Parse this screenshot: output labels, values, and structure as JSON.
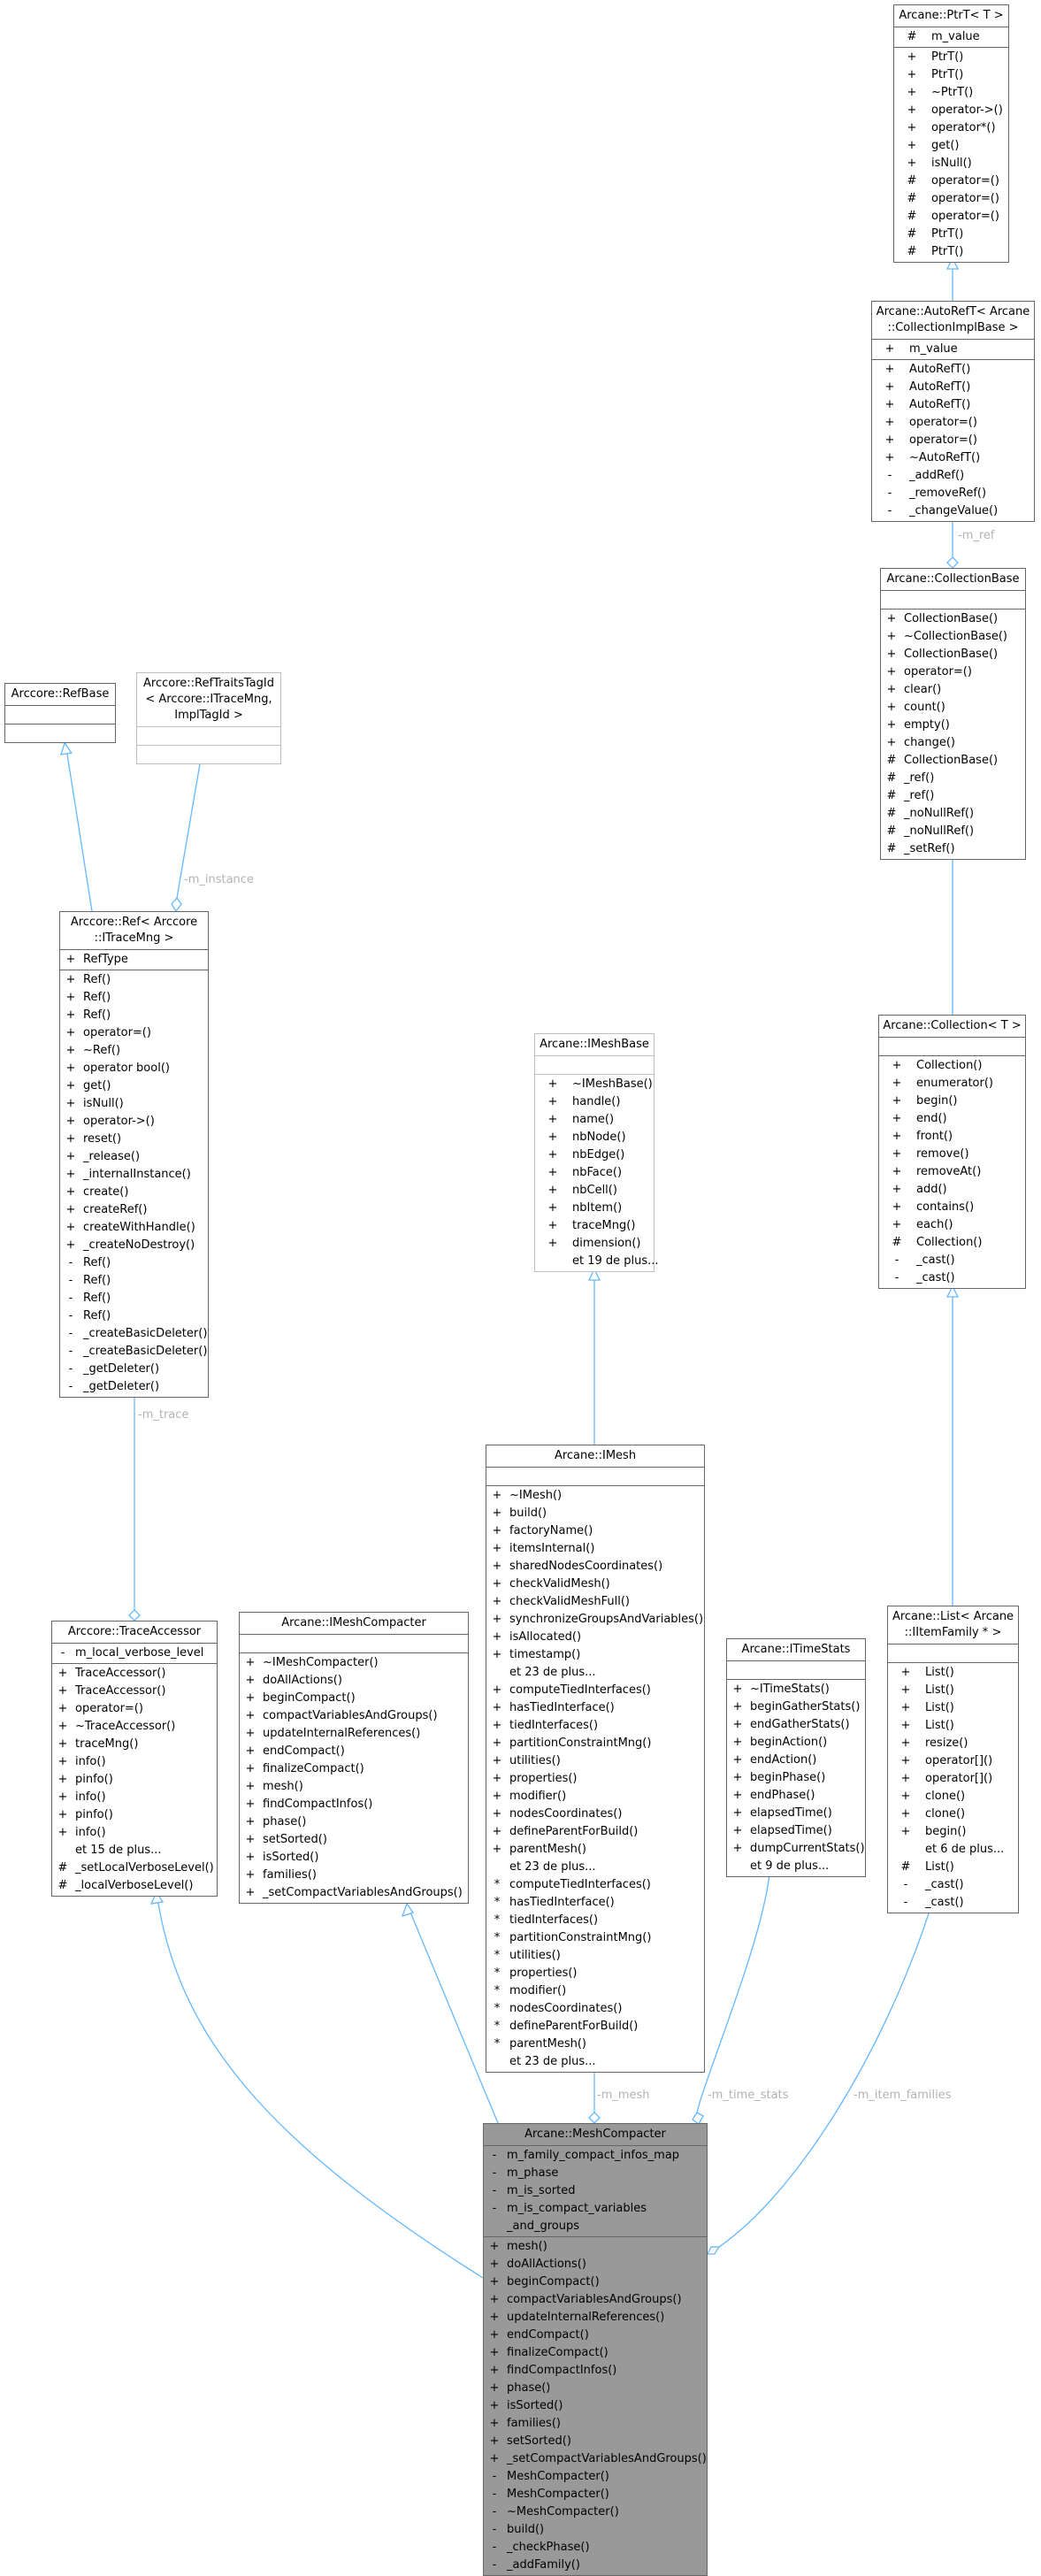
{
  "diagram": {
    "classes": {
      "ptrt": {
        "title": "Arcane::PtrT< T >",
        "attributes": [
          {
            "vis": "#",
            "name": "m_value"
          }
        ],
        "methods": [
          {
            "vis": "+",
            "name": "PtrT()"
          },
          {
            "vis": "+",
            "name": "PtrT()"
          },
          {
            "vis": "+",
            "name": "~PtrT()"
          },
          {
            "vis": "+",
            "name": "operator->()"
          },
          {
            "vis": "+",
            "name": "operator*()"
          },
          {
            "vis": "+",
            "name": "get()"
          },
          {
            "vis": "+",
            "name": "isNull()"
          },
          {
            "vis": "#",
            "name": "operator=()"
          },
          {
            "vis": "#",
            "name": "operator=()"
          },
          {
            "vis": "#",
            "name": "operator=()"
          },
          {
            "vis": "#",
            "name": "PtrT()"
          },
          {
            "vis": "#",
            "name": "PtrT()"
          }
        ]
      },
      "autoreft": {
        "title": "Arcane::AutoRefT< Arcane ::CollectionImplBase >",
        "attributes": [
          {
            "vis": "+",
            "name": "m_value"
          }
        ],
        "methods": [
          {
            "vis": "+",
            "name": "AutoRefT()"
          },
          {
            "vis": "+",
            "name": "AutoRefT()"
          },
          {
            "vis": "+",
            "name": "AutoRefT()"
          },
          {
            "vis": "+",
            "name": "operator=()"
          },
          {
            "vis": "+",
            "name": "operator=()"
          },
          {
            "vis": "+",
            "name": "~AutoRefT()"
          },
          {
            "vis": "-",
            "name": "_addRef()"
          },
          {
            "vis": "-",
            "name": "_removeRef()"
          },
          {
            "vis": "-",
            "name": "_changeValue()"
          }
        ]
      },
      "collectionbase": {
        "title": "Arcane::CollectionBase",
        "attributes": [],
        "methods": [
          {
            "vis": "+",
            "name": "CollectionBase()"
          },
          {
            "vis": "+",
            "name": "~CollectionBase()"
          },
          {
            "vis": "+",
            "name": "CollectionBase()"
          },
          {
            "vis": "+",
            "name": "operator=()"
          },
          {
            "vis": "+",
            "name": "clear()"
          },
          {
            "vis": "+",
            "name": "count()"
          },
          {
            "vis": "+",
            "name": "empty()"
          },
          {
            "vis": "+",
            "name": "change()"
          },
          {
            "vis": "#",
            "name": "CollectionBase()"
          },
          {
            "vis": "#",
            "name": "_ref()"
          },
          {
            "vis": "#",
            "name": "_ref()"
          },
          {
            "vis": "#",
            "name": "_noNullRef()"
          },
          {
            "vis": "#",
            "name": "_noNullRef()"
          },
          {
            "vis": "#",
            "name": "_setRef()"
          }
        ]
      },
      "collection": {
        "title": "Arcane::Collection< T >",
        "attributes": [],
        "methods": [
          {
            "vis": "+",
            "name": "Collection()"
          },
          {
            "vis": "+",
            "name": "enumerator()"
          },
          {
            "vis": "+",
            "name": "begin()"
          },
          {
            "vis": "+",
            "name": "end()"
          },
          {
            "vis": "+",
            "name": "front()"
          },
          {
            "vis": "+",
            "name": "remove()"
          },
          {
            "vis": "+",
            "name": "removeAt()"
          },
          {
            "vis": "+",
            "name": "add()"
          },
          {
            "vis": "+",
            "name": "contains()"
          },
          {
            "vis": "+",
            "name": "each()"
          },
          {
            "vis": "#",
            "name": "Collection()"
          },
          {
            "vis": "-",
            "name": "_cast()"
          },
          {
            "vis": "-",
            "name": "_cast()"
          }
        ]
      },
      "list": {
        "title": "Arcane::List< Arcane ::IItemFamily * >",
        "attributes": [],
        "methods": [
          {
            "vis": "+",
            "name": "List()"
          },
          {
            "vis": "+",
            "name": "List()"
          },
          {
            "vis": "+",
            "name": "List()"
          },
          {
            "vis": "+",
            "name": "List()"
          },
          {
            "vis": "+",
            "name": "resize()"
          },
          {
            "vis": "+",
            "name": "operator[]()"
          },
          {
            "vis": "+",
            "name": "operator[]()"
          },
          {
            "vis": "+",
            "name": "clone()"
          },
          {
            "vis": "+",
            "name": "clone()"
          },
          {
            "vis": "+",
            "name": "begin()"
          },
          {
            "vis": "",
            "name": "et 6 de plus..."
          },
          {
            "vis": "#",
            "name": "List()"
          },
          {
            "vis": "-",
            "name": "_cast()"
          },
          {
            "vis": "-",
            "name": "_cast()"
          }
        ]
      },
      "refbase": {
        "title": "Arccore::RefBase",
        "attributes": [],
        "methods": []
      },
      "reftraits": {
        "title": "Arccore::RefTraitsTagId < Arccore::ITraceMng, ImplTagId >",
        "attributes": [],
        "methods": []
      },
      "ref": {
        "title": "Arccore::Ref< Arccore ::ITraceMng >",
        "attributes": [
          {
            "vis": "+",
            "name": "RefType"
          }
        ],
        "methods": [
          {
            "vis": "+",
            "name": "Ref()"
          },
          {
            "vis": "+",
            "name": "Ref()"
          },
          {
            "vis": "+",
            "name": "Ref()"
          },
          {
            "vis": "+",
            "name": "operator=()"
          },
          {
            "vis": "+",
            "name": "~Ref()"
          },
          {
            "vis": "+",
            "name": "operator bool()"
          },
          {
            "vis": "+",
            "name": "get()"
          },
          {
            "vis": "+",
            "name": "isNull()"
          },
          {
            "vis": "+",
            "name": "operator->()"
          },
          {
            "vis": "+",
            "name": "reset()"
          },
          {
            "vis": "+",
            "name": "_release()"
          },
          {
            "vis": "+",
            "name": "_internalInstance()"
          },
          {
            "vis": "+",
            "name": "create()"
          },
          {
            "vis": "+",
            "name": "createRef()"
          },
          {
            "vis": "+",
            "name": "createWithHandle()"
          },
          {
            "vis": "+",
            "name": "_createNoDestroy()"
          },
          {
            "vis": "-",
            "name": "Ref()"
          },
          {
            "vis": "-",
            "name": "Ref()"
          },
          {
            "vis": "-",
            "name": "Ref()"
          },
          {
            "vis": "-",
            "name": "Ref()"
          },
          {
            "vis": "-",
            "name": "_createBasicDeleter()"
          },
          {
            "vis": "-",
            "name": "_createBasicDeleter()"
          },
          {
            "vis": "-",
            "name": "_getDeleter()"
          },
          {
            "vis": "-",
            "name": "_getDeleter()"
          }
        ]
      },
      "traceaccessor": {
        "title": "Arccore::TraceAccessor",
        "attributes": [
          {
            "vis": "-",
            "name": "m_local_verbose_level"
          }
        ],
        "methods": [
          {
            "vis": "+",
            "name": "TraceAccessor()"
          },
          {
            "vis": "+",
            "name": "TraceAccessor()"
          },
          {
            "vis": "+",
            "name": "operator=()"
          },
          {
            "vis": "+",
            "name": "~TraceAccessor()"
          },
          {
            "vis": "+",
            "name": "traceMng()"
          },
          {
            "vis": "+",
            "name": "info()"
          },
          {
            "vis": "+",
            "name": "pinfo()"
          },
          {
            "vis": "+",
            "name": "info()"
          },
          {
            "vis": "+",
            "name": "pinfo()"
          },
          {
            "vis": "+",
            "name": "info()"
          },
          {
            "vis": "",
            "name": "et 15 de plus..."
          },
          {
            "vis": "#",
            "name": "_setLocalVerboseLevel()"
          },
          {
            "vis": "#",
            "name": "_localVerboseLevel()"
          }
        ]
      },
      "imeshcompacter": {
        "title": "Arcane::IMeshCompacter",
        "attributes": [],
        "methods": [
          {
            "vis": "+",
            "name": "~IMeshCompacter()"
          },
          {
            "vis": "+",
            "name": "doAllActions()"
          },
          {
            "vis": "+",
            "name": "beginCompact()"
          },
          {
            "vis": "+",
            "name": "compactVariablesAndGroups()"
          },
          {
            "vis": "+",
            "name": "updateInternalReferences()"
          },
          {
            "vis": "+",
            "name": "endCompact()"
          },
          {
            "vis": "+",
            "name": "finalizeCompact()"
          },
          {
            "vis": "+",
            "name": "mesh()"
          },
          {
            "vis": "+",
            "name": "findCompactInfos()"
          },
          {
            "vis": "+",
            "name": "phase()"
          },
          {
            "vis": "+",
            "name": "setSorted()"
          },
          {
            "vis": "+",
            "name": "isSorted()"
          },
          {
            "vis": "+",
            "name": "families()"
          },
          {
            "vis": "+",
            "name": "_setCompactVariablesAndGroups()"
          }
        ]
      },
      "imeshbase": {
        "title": "Arcane::IMeshBase",
        "attributes": [],
        "methods": [
          {
            "vis": "+",
            "name": "~IMeshBase()"
          },
          {
            "vis": "+",
            "name": "handle()"
          },
          {
            "vis": "+",
            "name": "name()"
          },
          {
            "vis": "+",
            "name": "nbNode()"
          },
          {
            "vis": "+",
            "name": "nbEdge()"
          },
          {
            "vis": "+",
            "name": "nbFace()"
          },
          {
            "vis": "+",
            "name": "nbCell()"
          },
          {
            "vis": "+",
            "name": "nbItem()"
          },
          {
            "vis": "+",
            "name": "traceMng()"
          },
          {
            "vis": "+",
            "name": "dimension()"
          },
          {
            "vis": "",
            "name": "et 19 de plus..."
          }
        ]
      },
      "imesh": {
        "title": "Arcane::IMesh",
        "attributes": [],
        "methods": [
          {
            "vis": "+",
            "name": "~IMesh()"
          },
          {
            "vis": "+",
            "name": "build()"
          },
          {
            "vis": "+",
            "name": "factoryName()"
          },
          {
            "vis": "+",
            "name": "itemsInternal()"
          },
          {
            "vis": "+",
            "name": "sharedNodesCoordinates()"
          },
          {
            "vis": "+",
            "name": "checkValidMesh()"
          },
          {
            "vis": "+",
            "name": "checkValidMeshFull()"
          },
          {
            "vis": "+",
            "name": "synchronizeGroupsAndVariables()"
          },
          {
            "vis": "+",
            "name": "isAllocated()"
          },
          {
            "vis": "+",
            "name": "timestamp()"
          },
          {
            "vis": "",
            "name": "et 23 de plus..."
          },
          {
            "vis": "+",
            "name": "computeTiedInterfaces()"
          },
          {
            "vis": "+",
            "name": "hasTiedInterface()"
          },
          {
            "vis": "+",
            "name": "tiedInterfaces()"
          },
          {
            "vis": "+",
            "name": "partitionConstraintMng()"
          },
          {
            "vis": "+",
            "name": "utilities()"
          },
          {
            "vis": "+",
            "name": "properties()"
          },
          {
            "vis": "+",
            "name": "modifier()"
          },
          {
            "vis": "+",
            "name": "nodesCoordinates()"
          },
          {
            "vis": "+",
            "name": "defineParentForBuild()"
          },
          {
            "vis": "+",
            "name": "parentMesh()"
          },
          {
            "vis": "",
            "name": "et 23 de plus..."
          },
          {
            "vis": "*",
            "name": "computeTiedInterfaces()"
          },
          {
            "vis": "*",
            "name": "hasTiedInterface()"
          },
          {
            "vis": "*",
            "name": "tiedInterfaces()"
          },
          {
            "vis": "*",
            "name": "partitionConstraintMng()"
          },
          {
            "vis": "*",
            "name": "utilities()"
          },
          {
            "vis": "*",
            "name": "properties()"
          },
          {
            "vis": "*",
            "name": "modifier()"
          },
          {
            "vis": "*",
            "name": "nodesCoordinates()"
          },
          {
            "vis": "*",
            "name": "defineParentForBuild()"
          },
          {
            "vis": "*",
            "name": "parentMesh()"
          },
          {
            "vis": "",
            "name": "et 23 de plus..."
          }
        ]
      },
      "itimestats": {
        "title": "Arcane::ITimeStats",
        "attributes": [],
        "methods": [
          {
            "vis": "+",
            "name": "~ITimeStats()"
          },
          {
            "vis": "+",
            "name": "beginGatherStats()"
          },
          {
            "vis": "+",
            "name": "endGatherStats()"
          },
          {
            "vis": "+",
            "name": "beginAction()"
          },
          {
            "vis": "+",
            "name": "endAction()"
          },
          {
            "vis": "+",
            "name": "beginPhase()"
          },
          {
            "vis": "+",
            "name": "endPhase()"
          },
          {
            "vis": "+",
            "name": "elapsedTime()"
          },
          {
            "vis": "+",
            "name": "elapsedTime()"
          },
          {
            "vis": "+",
            "name": "dumpCurrentStats()"
          },
          {
            "vis": "",
            "name": "et 9 de plus..."
          }
        ]
      },
      "meshcompacter": {
        "title": "Arcane::MeshCompacter",
        "attributes": [
          {
            "vis": "-",
            "name": "m_family_compact_infos_map"
          },
          {
            "vis": "-",
            "name": "m_phase"
          },
          {
            "vis": "-",
            "name": "m_is_sorted"
          },
          {
            "vis": "-",
            "name": "m_is_compact_variables"
          },
          {
            "vis": "",
            "name": "_and_groups"
          }
        ],
        "methods": [
          {
            "vis": "+",
            "name": "mesh()"
          },
          {
            "vis": "+",
            "name": "doAllActions()"
          },
          {
            "vis": "+",
            "name": "beginCompact()"
          },
          {
            "vis": "+",
            "name": "compactVariablesAndGroups()"
          },
          {
            "vis": "+",
            "name": "updateInternalReferences()"
          },
          {
            "vis": "+",
            "name": "endCompact()"
          },
          {
            "vis": "+",
            "name": "finalizeCompact()"
          },
          {
            "vis": "+",
            "name": "findCompactInfos()"
          },
          {
            "vis": "+",
            "name": "phase()"
          },
          {
            "vis": "+",
            "name": "isSorted()"
          },
          {
            "vis": "+",
            "name": "families()"
          },
          {
            "vis": "+",
            "name": "setSorted()"
          },
          {
            "vis": "+",
            "name": "_setCompactVariablesAndGroups()"
          },
          {
            "vis": "-",
            "name": "MeshCompacter()"
          },
          {
            "vis": "-",
            "name": "MeshCompacter()"
          },
          {
            "vis": "-",
            "name": "~MeshCompacter()"
          },
          {
            "vis": "-",
            "name": "build()"
          },
          {
            "vis": "-",
            "name": "_checkPhase()"
          },
          {
            "vis": "-",
            "name": "_addFamily()"
          }
        ]
      }
    },
    "edge_labels": {
      "m_ref": "-m_ref",
      "m_instance": "-m_instance",
      "m_trace": "-m_trace",
      "m_mesh": "-m_mesh",
      "m_time_stats": "-m_time_stats",
      "m_item_families": "-m_item_families"
    },
    "colors": {
      "edge": "#63b8ff",
      "focus_fill": "#999999",
      "box_border": "#666666",
      "light_border": "#bfbfbf",
      "label": "#b3b3b3"
    }
  }
}
